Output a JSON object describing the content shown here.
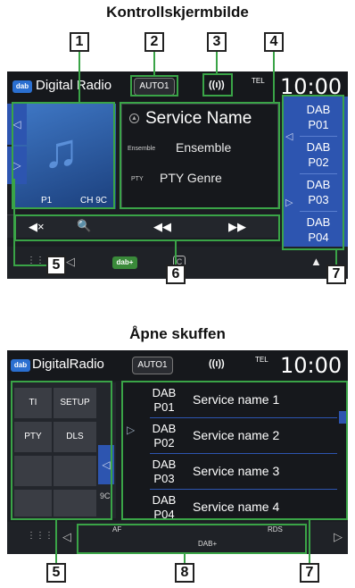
{
  "titles": {
    "control_screen": "Kontrollskjermbilde",
    "open_drawer": "Åpne skuffen"
  },
  "callout_numbers": [
    "1",
    "2",
    "3",
    "4",
    "5",
    "6",
    "7",
    "8"
  ],
  "screen1": {
    "status": {
      "logo": "dab",
      "logo_plus": "+",
      "app_title": "Digital Radio",
      "auto_button": "AUTO1",
      "antenna": "((ı))",
      "tel": "TEL",
      "clock": "10:00"
    },
    "art": {
      "preset": "P1",
      "channel": "CH 9C"
    },
    "info": {
      "service_name": "Service Name",
      "ensemble_label": "Ensemble",
      "ensemble_value": "Ensemble",
      "pty_label": "PTY",
      "pty_value": "PTY Genre"
    },
    "presets": [
      {
        "line1": "DAB",
        "line2": "P01"
      },
      {
        "line1": "DAB",
        "line2": "P02"
      },
      {
        "line1": "DAB",
        "line2": "P03"
      },
      {
        "line1": "DAB",
        "line2": "P04"
      }
    ],
    "controls": {
      "mute": "◀×",
      "search": "🔍",
      "prev": "◀◀",
      "next": "▶▶"
    },
    "bottom": {
      "menu": "⋮⋮⋮",
      "back": "◁",
      "dab_logo": "dab+",
      "c_icon": "C",
      "nav": "▲"
    }
  },
  "screen2": {
    "status": {
      "logo": "dab",
      "logo_plus": "+",
      "app_title": "DigitalRadio",
      "auto_button": "AUTO1",
      "antenna": "((ı))",
      "tel": "TEL",
      "clock": "10:00"
    },
    "drawer": {
      "ti": "TI",
      "setup": "SETUP",
      "pty": "PTY",
      "dls": "DLS",
      "partial": "9C"
    },
    "list": [
      {
        "line1": "DAB",
        "line2": "P01",
        "name": "Service name 1"
      },
      {
        "line1": "DAB",
        "line2": "P02",
        "name": "Service name 2"
      },
      {
        "line1": "DAB",
        "line2": "P03",
        "name": "Service name 3"
      },
      {
        "line1": "DAB",
        "line2": "P04",
        "name": "Service name 4"
      }
    ],
    "bottom": {
      "menu": "⋮⋮⋮",
      "back": "◁",
      "af": "AF",
      "rds": "RDS",
      "dabplus": "DAB+",
      "forward": "▷"
    }
  }
}
